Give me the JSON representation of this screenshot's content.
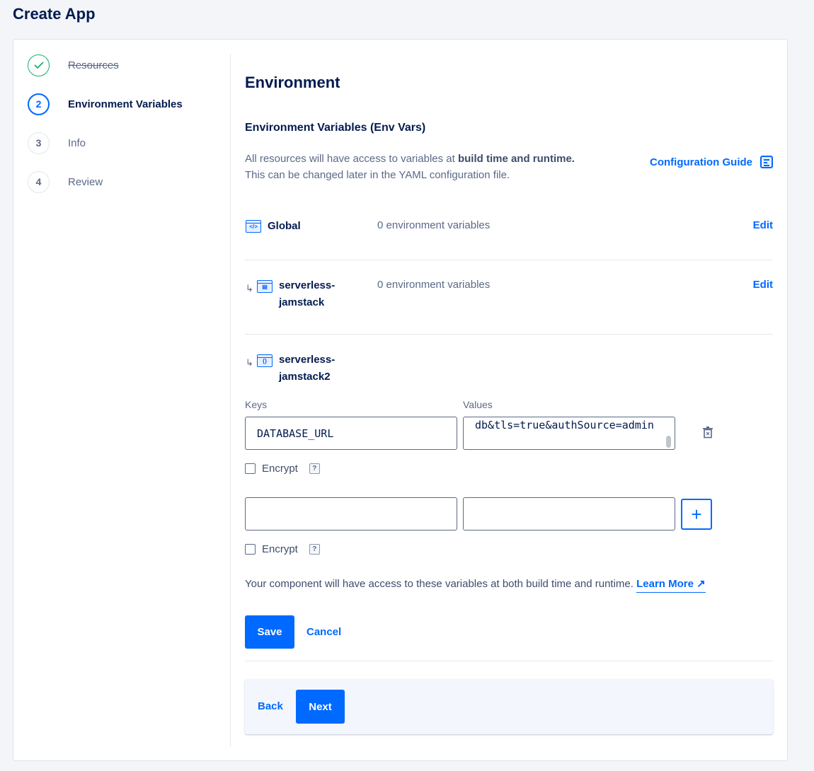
{
  "page": {
    "title": "Create App"
  },
  "stepper": {
    "steps": [
      {
        "number": "",
        "label": "Resources",
        "state": "done"
      },
      {
        "number": "2",
        "label": "Environment Variables",
        "state": "active"
      },
      {
        "number": "3",
        "label": "Info",
        "state": "pending"
      },
      {
        "number": "4",
        "label": "Review",
        "state": "pending"
      }
    ]
  },
  "main": {
    "heading": "Environment",
    "subheading": "Environment Variables (Env Vars)",
    "description_line1_prefix": "All resources will have access to variables at ",
    "description_line1_bold": "build time and runtime.",
    "description_line2": "This can be changed later in the YAML configuration file.",
    "config_guide_label": "Configuration Guide",
    "components": [
      {
        "name": "Global",
        "count": "0 environment variables",
        "edit_label": "Edit",
        "icon": "code-window-icon"
      },
      {
        "name_line1": "serverless-",
        "name_line2": "jamstack",
        "count": "0 environment variables",
        "edit_label": "Edit",
        "icon": "static-site-icon"
      },
      {
        "name_line1": "serverless-",
        "name_line2": "jamstack2",
        "icon": "functions-icon"
      }
    ],
    "env_editor": {
      "keys_label": "Keys",
      "values_label": "Values",
      "rows": [
        {
          "key": "DATABASE_URL",
          "value": "db&tls=true&authSource=admin",
          "encrypt_label": "Encrypt",
          "encrypt_checked": false
        },
        {
          "key": "",
          "value": "",
          "encrypt_label": "Encrypt",
          "encrypt_checked": false
        }
      ],
      "help_glyph": "?",
      "add_glyph": "+"
    },
    "note_text": "Your component will have access to these variables at both build time and runtime.",
    "learn_more_label": "Learn More",
    "learn_more_glyph": "↗",
    "save_label": "Save",
    "cancel_label": "Cancel"
  },
  "footer": {
    "back_label": "Back",
    "next_label": "Next"
  },
  "colors": {
    "accent": "#0069ff",
    "success": "#15b06a",
    "text": "#031b4e",
    "muted": "#5b6987"
  }
}
